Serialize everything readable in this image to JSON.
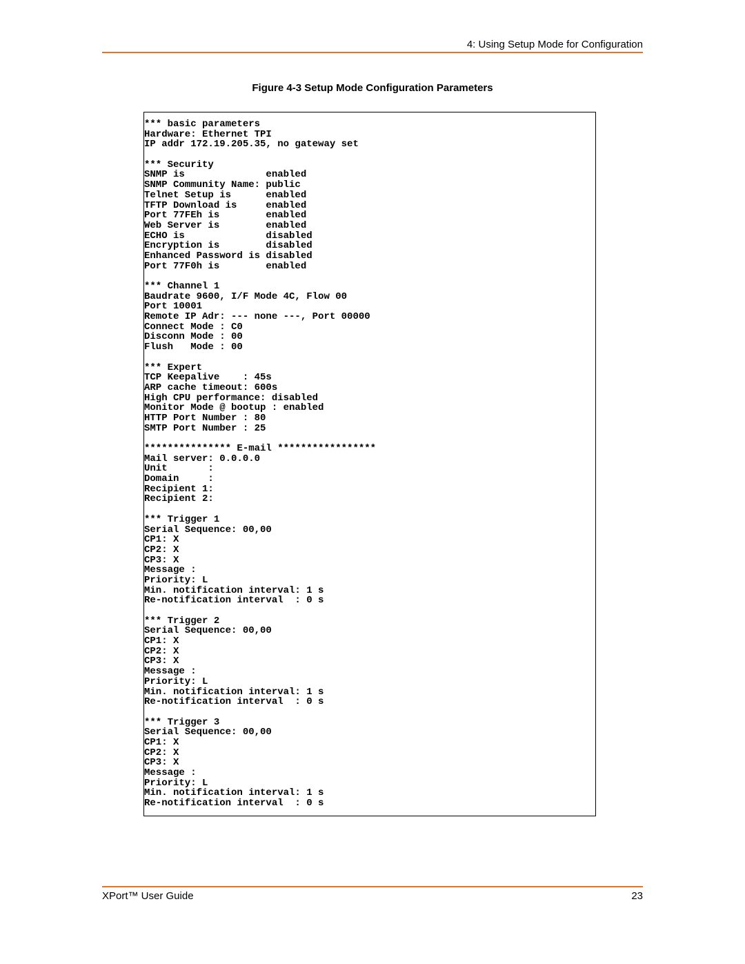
{
  "header": {
    "section_text": "4: Using Setup Mode for Configuration"
  },
  "figure": {
    "caption": "Figure 4-3  Setup Mode Configuration Parameters",
    "terminal_text": "*** basic parameters\nHardware: Ethernet TPI\nIP addr 172.19.205.35, no gateway set\n\n*** Security\nSNMP is              enabled\nSNMP Community Name: public\nTelnet Setup is      enabled\nTFTP Download is     enabled\nPort 77FEh is        enabled\nWeb Server is        enabled\nECHO is              disabled\nEncryption is        disabled\nEnhanced Password is disabled\nPort 77F0h is        enabled\n\n*** Channel 1\nBaudrate 9600, I/F Mode 4C, Flow 00\nPort 10001\nRemote IP Adr: --- none ---, Port 00000\nConnect Mode : C0\nDisconn Mode : 00\nFlush   Mode : 00\n\n*** Expert\nTCP Keepalive    : 45s\nARP cache timeout: 600s\nHigh CPU performance: disabled\nMonitor Mode @ bootup : enabled\nHTTP Port Number : 80\nSMTP Port Number : 25\n\n*************** E-mail *****************\nMail server: 0.0.0.0\nUnit       :\nDomain     :\nRecipient 1:\nRecipient 2:\n\n*** Trigger 1\nSerial Sequence: 00,00\nCP1: X\nCP2: X\nCP3: X\nMessage :\nPriority: L\nMin. notification interval: 1 s\nRe-notification interval  : 0 s\n\n*** Trigger 2\nSerial Sequence: 00,00\nCP1: X\nCP2: X\nCP3: X\nMessage :\nPriority: L\nMin. notification interval: 1 s\nRe-notification interval  : 0 s\n\n*** Trigger 3\nSerial Sequence: 00,00\nCP1: X\nCP2: X\nCP3: X\nMessage :\nPriority: L\nMin. notification interval: 1 s\nRe-notification interval  : 0 s"
  },
  "footer": {
    "doc_title": "XPort™ User Guide",
    "page_number": "23"
  }
}
